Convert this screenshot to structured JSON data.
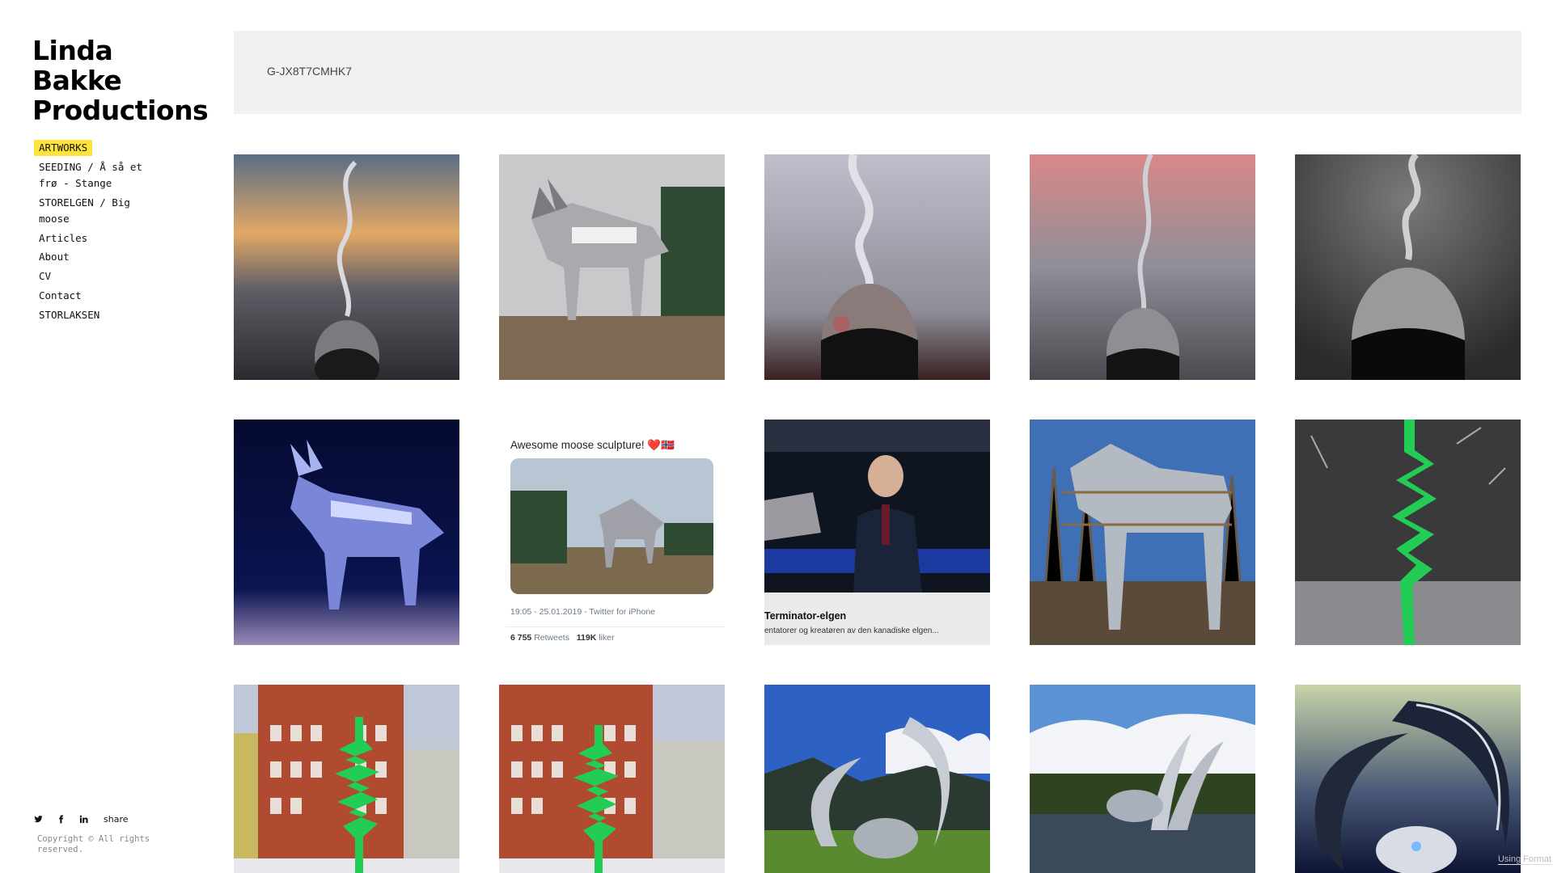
{
  "site": {
    "title_lines": [
      "Linda",
      "Bakke",
      "Productions"
    ]
  },
  "nav": {
    "items": [
      {
        "label": "ARTWORKS",
        "active": true
      },
      {
        "label": "SEEDING / Å så et frø - Stange"
      },
      {
        "label": "STORELGEN / Big moose"
      },
      {
        "label": "Articles"
      },
      {
        "label": "About"
      },
      {
        "label": "CV"
      },
      {
        "label": "Contact"
      },
      {
        "label": "STORLAKSEN"
      }
    ]
  },
  "social": {
    "icons": [
      "twitter-icon",
      "facebook-icon",
      "linkedin-icon"
    ],
    "share_label": "share"
  },
  "footer": {
    "copyright": "Copyright © All rights reserved.",
    "made_with": "Using Format"
  },
  "banner": {
    "text": "G-JX8T7CMHK7"
  },
  "gallery": {
    "tiles": [
      {
        "subject": "seed sculpture at sunset",
        "palette": [
          "#c8a070",
          "#4a4a50"
        ]
      },
      {
        "subject": "big moose sculpture with snow",
        "palette": [
          "#bcbcbc",
          "#6b5a45"
        ]
      },
      {
        "subject": "seed sculpture closeup",
        "palette": [
          "#9a9aa8",
          "#2a2a2a"
        ]
      },
      {
        "subject": "seed sculpture pink sky",
        "palette": [
          "#d08a8a",
          "#3a3a3a"
        ]
      },
      {
        "subject": "seed sculpture black and white",
        "palette": [
          "#5a5a5a",
          "#111111"
        ]
      },
      {
        "subject": "moose sculpture at night",
        "palette": [
          "#102060",
          "#8090d0"
        ]
      },
      {
        "subject": "tweet screenshot",
        "tweet_text": "Awesome moose sculpture! ❤️🇳🇴",
        "tweet_meta": "19:05 - 25.01.2019 - Twitter for iPhone",
        "tweet_stats_retweets": "6 755",
        "tweet_stats_retweets_label": "Retweets",
        "tweet_stats_likes": "119K",
        "tweet_stats_likes_label": "liker"
      },
      {
        "subject": "tv show screenshot",
        "caption_title": "Terminator-elgen",
        "caption_sub": "entatorer og kreatøren av den kanadiske elgen..."
      },
      {
        "subject": "moose sculpture under construction",
        "palette": [
          "#3a6ab0",
          "#aab0b8"
        ]
      },
      {
        "subject": "green zigzag sculpture in snow",
        "palette": [
          "#3a3a3a",
          "#22cc55"
        ]
      },
      {
        "subject": "green sculpture at red building",
        "palette": [
          "#b84a30",
          "#22cc55"
        ]
      },
      {
        "subject": "green sculpture at red building 2",
        "palette": [
          "#b84a30",
          "#22cc55"
        ]
      },
      {
        "subject": "chrome crescent sculpture landscape",
        "palette": [
          "#3a70c8",
          "#5a8a30"
        ]
      },
      {
        "subject": "chrome mammoth sculpture in water",
        "palette": [
          "#5a90d0",
          "#2a4020"
        ]
      },
      {
        "subject": "chrome crescent sculpture tinted",
        "palette": [
          "#b8c8a0",
          "#142050"
        ]
      }
    ]
  },
  "colors": {
    "nav_active_bg": "#ffe33a",
    "banner_bg": "#f1f1f1"
  }
}
